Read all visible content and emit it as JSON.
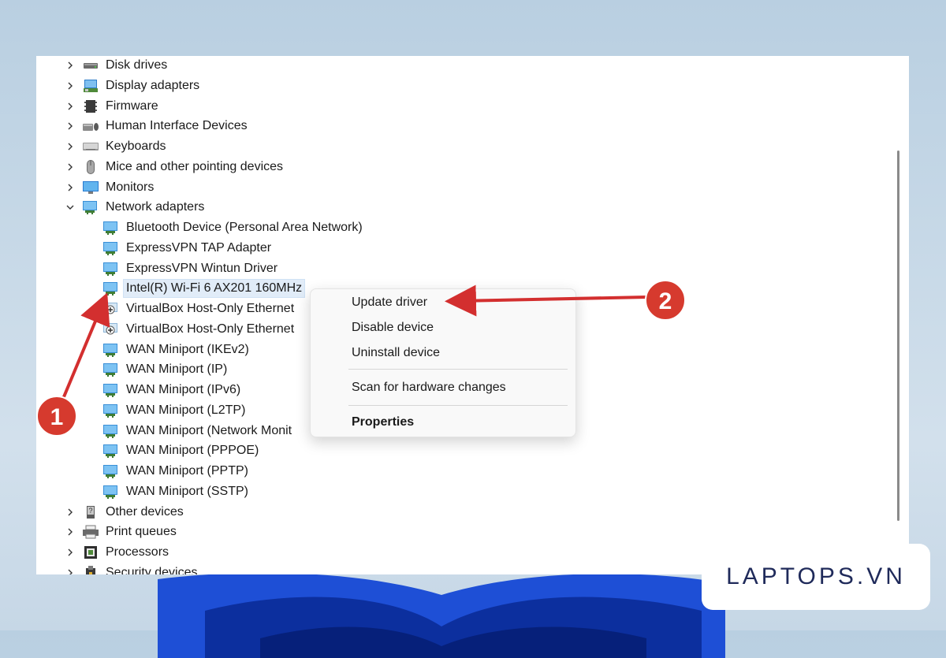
{
  "tree": {
    "categories_top": [
      {
        "label": "Disk drives",
        "icon": "disk-drive-icon"
      },
      {
        "label": "Display adapters",
        "icon": "display-adapter-icon"
      },
      {
        "label": "Firmware",
        "icon": "firmware-icon"
      },
      {
        "label": "Human Interface Devices",
        "icon": "hid-icon"
      },
      {
        "label": "Keyboards",
        "icon": "keyboard-icon"
      },
      {
        "label": "Mice and other pointing devices",
        "icon": "mouse-icon"
      },
      {
        "label": "Monitors",
        "icon": "monitor-icon"
      }
    ],
    "network_adapters": {
      "label": "Network adapters",
      "icon": "network-adapter-icon",
      "children": [
        "Bluetooth Device (Personal Area Network)",
        "ExpressVPN TAP Adapter",
        "ExpressVPN Wintun Driver",
        "Intel(R) Wi-Fi 6 AX201 160MHz",
        "VirtualBox Host-Only Ethernet",
        "VirtualBox Host-Only Ethernet",
        "WAN Miniport (IKEv2)",
        "WAN Miniport (IP)",
        "WAN Miniport (IPv6)",
        "WAN Miniport (L2TP)",
        "WAN Miniport (Network Monit",
        "WAN Miniport (PPPOE)",
        "WAN Miniport (PPTP)",
        "WAN Miniport (SSTP)"
      ]
    },
    "categories_bottom": [
      {
        "label": "Other devices",
        "icon": "other-devices-icon"
      },
      {
        "label": "Print queues",
        "icon": "printer-icon"
      },
      {
        "label": "Processors",
        "icon": "processor-icon"
      },
      {
        "label": "Security devices",
        "icon": "security-device-icon"
      }
    ]
  },
  "context_menu": {
    "update_driver": "Update driver",
    "disable_device": "Disable device",
    "uninstall_device": "Uninstall device",
    "scan_hardware": "Scan for hardware changes",
    "properties": "Properties"
  },
  "annotations": {
    "step1": "1",
    "step2": "2",
    "color": "#d32f2f"
  },
  "watermark": {
    "text": "LAPTOPS.VN"
  },
  "colors": {
    "adapter_blue": "#3a8fd6",
    "selection": "#e1ecf8"
  }
}
